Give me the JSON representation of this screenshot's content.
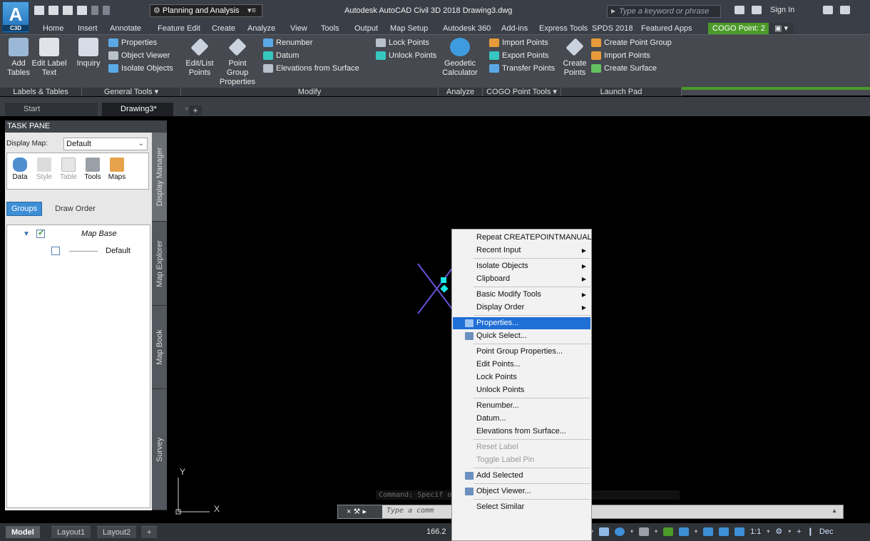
{
  "app": {
    "logo_text": "A",
    "logo_sub": "C3D",
    "workspace": "Planning and Analysis",
    "title": "Autodesk AutoCAD Civil 3D 2018    Drawing3.dwg",
    "search_placeholder": "Type a keyword or phrase",
    "sign_in": "Sign In"
  },
  "ribbon_tabs": [
    "Home",
    "Insert",
    "Annotate",
    "Feature Edit",
    "Create",
    "Analyze",
    "View",
    "Tools",
    "Output",
    "Map Setup",
    "Autodesk 360",
    "Add-ins",
    "Express Tools",
    "SPDS 2018",
    "Featured Apps"
  ],
  "context_tab": "COGO Point: 2",
  "ribbon": {
    "add_tables": [
      "Add",
      "Tables"
    ],
    "edit_label_text": [
      "Edit Label",
      "Text"
    ],
    "inquiry": "Inquiry",
    "properties": "Properties",
    "object_viewer": "Object Viewer",
    "isolate_objects": "Isolate Objects",
    "edit_list_points": [
      "Edit/List",
      "Points"
    ],
    "point_group_properties": [
      "Point Group",
      "Properties"
    ],
    "renumber": "Renumber",
    "datum": "Datum",
    "elevations_from_surface": "Elevations from Surface",
    "lock_points": "Lock Points",
    "unlock_points": "Unlock Points",
    "geodetic_calculator": [
      "Geodetic",
      "Calculator"
    ],
    "import_points": "Import Points",
    "export_points": "Export Points",
    "transfer_points": "Transfer Points",
    "create_points": [
      "Create",
      "Points"
    ],
    "create_point_group": "Create Point Group",
    "import_points_2": "Import Points",
    "create_surface": "Create Surface"
  },
  "panels": [
    "Labels & Tables",
    "General Tools ▾",
    "Modify",
    "Analyze",
    "COGO Point Tools ▾",
    "Launch Pad"
  ],
  "doc_tabs": {
    "start": "Start",
    "drawing": "Drawing3*",
    "plus": "+"
  },
  "task_pane": {
    "title": "TASK PANE",
    "display_map_label": "Display Map:",
    "display_map_value": "Default",
    "tools": [
      "Data",
      "Style",
      "Table",
      "Tools",
      "Maps"
    ],
    "groups": "Groups",
    "draw_order": "Draw Order",
    "tree_root": "Map Base",
    "tree_child": "Default",
    "vertical_tabs": [
      "Display Manager",
      "Map Explorer",
      "Map Book",
      "Survey"
    ]
  },
  "axes": {
    "y": "Y",
    "x": "X"
  },
  "context_menu": [
    {
      "label": "Repeat CREATEPOINTMANUAL"
    },
    {
      "label": "Recent Input",
      "submenu": true
    },
    {
      "sep": true
    },
    {
      "label": "Isolate Objects",
      "submenu": true
    },
    {
      "label": "Clipboard",
      "submenu": true
    },
    {
      "sep": true
    },
    {
      "label": "Basic Modify Tools",
      "submenu": true
    },
    {
      "label": "Display Order",
      "submenu": true
    },
    {
      "sep": true
    },
    {
      "label": "Properties...",
      "selected": true,
      "icon": "properties-icon"
    },
    {
      "label": "Quick Select...",
      "icon": "quick-select-icon"
    },
    {
      "sep": true
    },
    {
      "label": "Point Group Properties..."
    },
    {
      "label": "Edit Points..."
    },
    {
      "label": "Lock Points"
    },
    {
      "label": "Unlock Points"
    },
    {
      "sep": true
    },
    {
      "label": "Renumber..."
    },
    {
      "label": "Datum..."
    },
    {
      "label": "Elevations from Surface..."
    },
    {
      "sep": true
    },
    {
      "label": "Reset Label",
      "disabled": true
    },
    {
      "label": "Toggle Label Pin",
      "disabled": true
    },
    {
      "sep": true
    },
    {
      "label": "Add Selected",
      "icon": "add-selected-icon"
    },
    {
      "sep": true
    },
    {
      "label": "Object Viewer...",
      "icon": "object-viewer-icon"
    },
    {
      "sep": true
    },
    {
      "label": "Select Similar"
    }
  ],
  "command": {
    "history": "Command: Specif                                       olygon/CPolygon]:",
    "placeholder": "Type a comm"
  },
  "status": {
    "layouts": [
      "Model",
      "Layout1",
      "Layout2",
      "+"
    ],
    "coords": "166.2",
    "scale": "1:1",
    "right_text": "Dec"
  },
  "colors": {
    "accent_green": "#4c9a2a",
    "selection_blue": "#1f6fd6",
    "point_cyan": "#1ee6e6",
    "point_purple": "#6a4fd8"
  }
}
